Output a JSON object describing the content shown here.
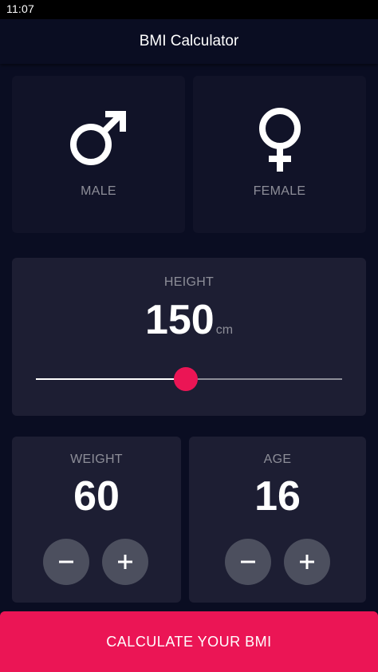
{
  "status_bar": {
    "time": "11:07"
  },
  "app_bar": {
    "title": "BMI Calculator"
  },
  "gender": {
    "male_label": "MALE",
    "female_label": "FEMALE",
    "male_icon": "male-symbol-icon",
    "female_icon": "female-symbol-icon"
  },
  "height": {
    "label": "HEIGHT",
    "value": "150",
    "unit": "cm",
    "slider_fraction": 0.49
  },
  "weight": {
    "label": "WEIGHT",
    "value": "60"
  },
  "age": {
    "label": "AGE",
    "value": "16"
  },
  "action": {
    "label": "CALCULATE YOUR BMI"
  },
  "colors": {
    "background": "#0a0d22",
    "card_active": "#1d1e33",
    "card_inactive": "#111328",
    "accent": "#eb1555",
    "label_grey": "#8d8e98",
    "button_grey": "#4c4f5e"
  }
}
